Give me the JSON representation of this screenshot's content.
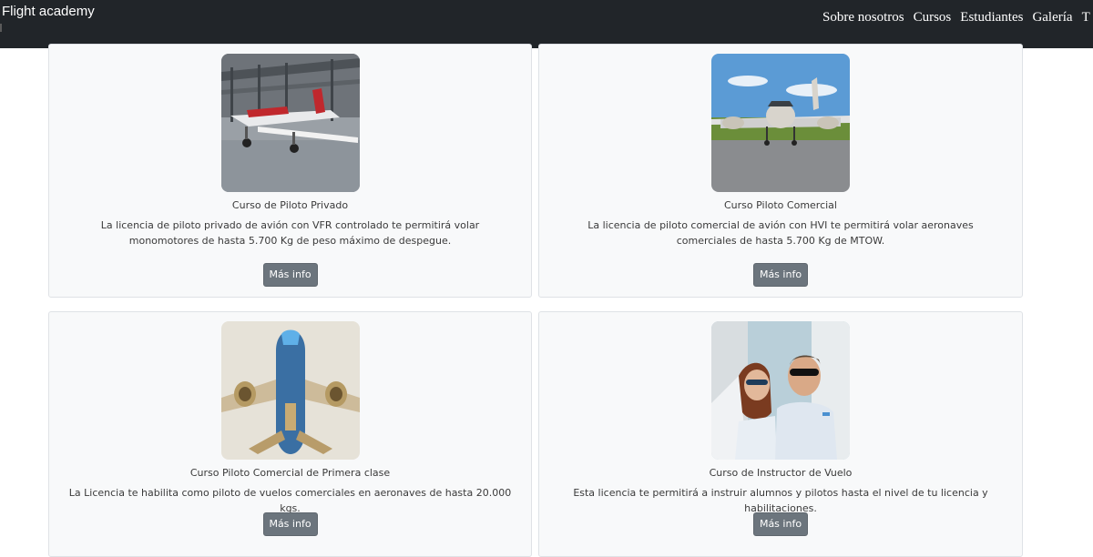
{
  "navbar": {
    "brand": "Flight academy",
    "links": [
      "Sobre nosotros",
      "Cursos",
      "Estudiantes",
      "Galería",
      "T"
    ]
  },
  "courses": [
    {
      "title": "Curso de Piloto Privado",
      "text": "La licencia de piloto privado de avión con VFR controlado te permitirá volar monomotores de hasta 5.700 Kg de peso máximo de despegue.",
      "button": "Más info",
      "image": "red-white-plane-in-hangar"
    },
    {
      "title": "Curso Piloto Comercial",
      "text": "La licencia de piloto comercial de avión con HVI te permitirá volar aeronaves comerciales de hasta 5.700 Kg de MTOW.",
      "button": "Más info",
      "image": "twin-engine-plane-on-tarmac"
    },
    {
      "title": "Curso Piloto Comercial de Primera clase",
      "text": "La Licencia te habilita como piloto de vuelos comerciales en aeronaves de hasta 20.000 kgs.",
      "button": "Más info",
      "image": "jet-airliner-taking-off"
    },
    {
      "title": "Curso de Instructor de Vuelo",
      "text": "Esta licencia te permitirá a instruir alumnos y pilotos hasta el nivel de tu licencia y habilitaciones.",
      "button": "Más info",
      "image": "two-pilots-with-sunglasses"
    }
  ],
  "colors": {
    "navbar_bg": "#212529",
    "card_bg": "#f8f9fa",
    "button_bg": "#6c757d"
  }
}
